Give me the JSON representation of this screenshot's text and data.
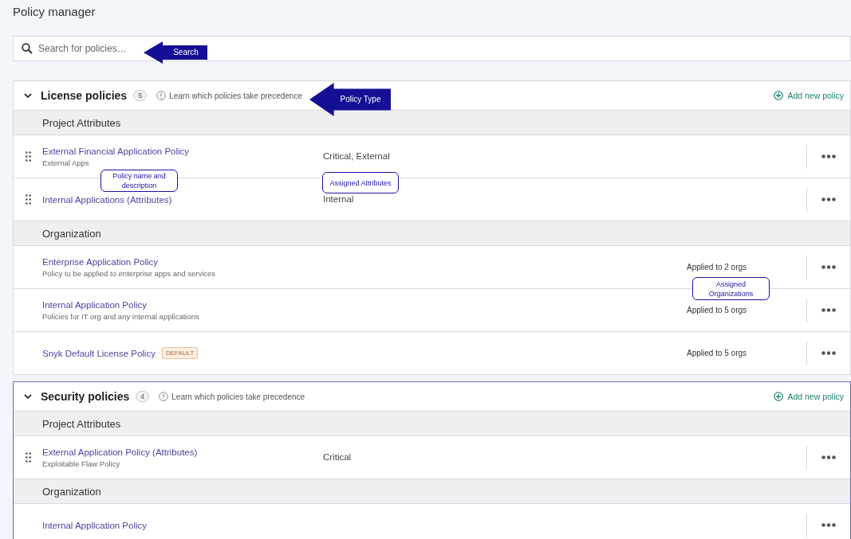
{
  "title": "Policy manager",
  "search": {
    "placeholder": "Search for policies…"
  },
  "sections": [
    {
      "title": "License policies",
      "count": "5",
      "help": "Learn which policies take precedence",
      "add": "Add new policy",
      "highlighted": false,
      "expanded": true,
      "groups": [
        {
          "title": "Project Attributes",
          "rows": [
            {
              "name": "External Financial Application Policy",
              "description": "External Apps",
              "attributes": "Critical, External",
              "draggable": true
            },
            {
              "name": "Internal Applications (Attributes)",
              "attributes": "Internal",
              "draggable": true
            }
          ]
        },
        {
          "title": "Organization",
          "rows": [
            {
              "name": "Enterprise Application Policy",
              "description": "Policy to be applied to enterprise apps and services",
              "orgs": "Applied to 2 orgs",
              "draggable": false
            },
            {
              "name": "Internal Application Policy",
              "description": "Policies for IT org and any internal applications",
              "orgs": "Applied to 5 orgs",
              "draggable": false
            },
            {
              "name": "Snyk Default License Policy",
              "badge": "DEFAULT",
              "orgs": "Applied to 5 orgs",
              "draggable": false
            }
          ]
        }
      ]
    },
    {
      "title": "Security policies",
      "count": "4",
      "help": "Learn which policies take precedence",
      "add": "Add new policy",
      "highlighted": true,
      "expanded": true,
      "groups": [
        {
          "title": "Project Attributes",
          "rows": [
            {
              "name": "External Application Policy (Attributes)",
              "description": "Exploitable Flaw Policy",
              "attributes": "Critical",
              "draggable": true
            }
          ]
        },
        {
          "title": "Organization",
          "rows": [
            {
              "name": "Internal Application Policy",
              "draggable": false
            }
          ]
        }
      ]
    }
  ],
  "annotations": [
    {
      "kind": "arrow",
      "text": "Search"
    },
    {
      "kind": "arrow",
      "text": "Policy Type"
    },
    {
      "kind": "box",
      "text": "Policy name and description"
    },
    {
      "kind": "box",
      "text": "Assigned Attributes"
    },
    {
      "kind": "box",
      "text": "Assigned Organizations"
    }
  ]
}
